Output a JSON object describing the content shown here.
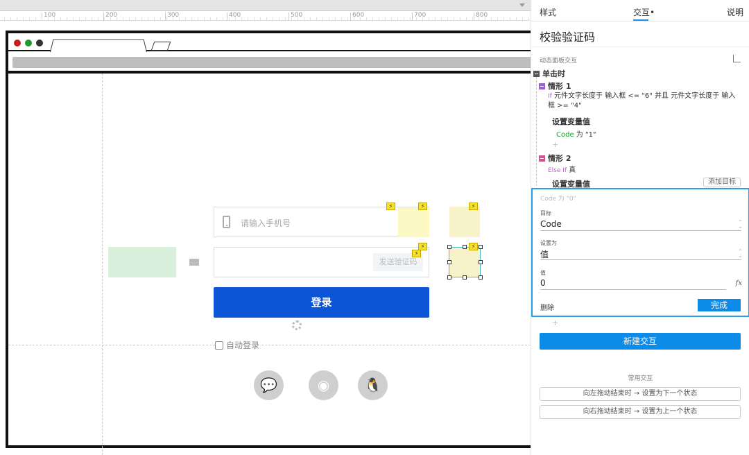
{
  "ruler": {
    "ticks": [
      "100",
      "200",
      "300",
      "400",
      "500",
      "600",
      "700",
      "800"
    ]
  },
  "canvas": {
    "phone_placeholder": "请输入手机号",
    "send_code_label": "发送验证码",
    "login_label": "登录",
    "auto_login_label": "自动登录",
    "bolt_glyph": "⚡",
    "social": [
      {
        "icon": "wechat-icon",
        "glyph": "💬"
      },
      {
        "icon": "weibo-icon",
        "glyph": "◉"
      },
      {
        "icon": "qq-icon",
        "glyph": "🐧"
      }
    ],
    "colors": {
      "login": "#0b55d6",
      "green_box": "#d8f0dc",
      "yellow_box": "#fdf9c4"
    }
  },
  "panel": {
    "tabs": {
      "style": "样式",
      "interaction": "交互",
      "interaction_dot": "•",
      "notes": "说明"
    },
    "title": "校验验证码",
    "section_label": "动态面板交互",
    "event": "单击时",
    "case1": {
      "name": "情形 1",
      "if_kw": "If",
      "condition": "元件文字长度于 输入框 <= \"6\" 并且 元件文字长度于 输入框 >= \"4\"",
      "action": "设置变量值",
      "detail_var": "Code",
      "detail_rest": " 为 \"1\""
    },
    "case2": {
      "name": "情形 2",
      "if_kw": "Else If",
      "condition": "真",
      "action": "设置变量值",
      "add_target": "添加目标"
    },
    "editor": {
      "summary": "Code 为 \"0\"",
      "target_label": "目标",
      "target_value": "Code",
      "setto_label": "设置为",
      "setto_value": "值",
      "value_label": "值",
      "value_value": "0",
      "fx": "fx",
      "delete_label": "删除",
      "done_label": "完成"
    },
    "new_interaction": "新建交互",
    "common_label": "常用交互",
    "common_items": [
      "向左拖动结束时 → 设置为下一个状态",
      "向右拖动结束时 → 设置为上一个状态"
    ],
    "accent": "#0d8be8"
  }
}
